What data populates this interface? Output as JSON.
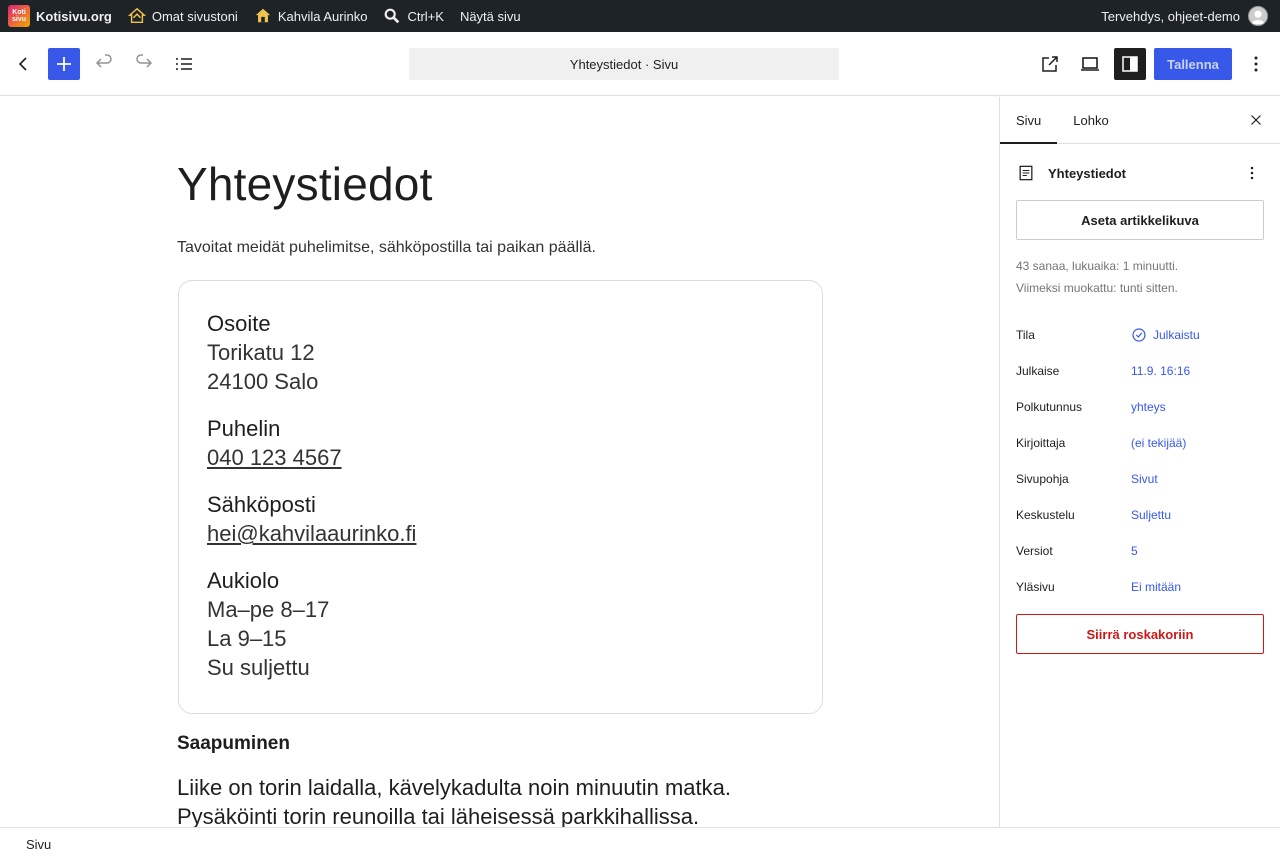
{
  "adminbar": {
    "logo_text": "Koti sivu",
    "site_name": "Kotisivu.org",
    "my_sites": "Omat sivustoni",
    "site": "Kahvila Aurinko",
    "search": "Ctrl+K",
    "view_page": "Näytä sivu",
    "greeting": "Tervehdys, ohjeet-demo"
  },
  "header": {
    "document_title": "Yhteystiedot · Sivu",
    "save_label": "Tallenna"
  },
  "content": {
    "title": "Yhteystiedot",
    "lead": "Tavoitat meidät puhelimitse, sähköpostilla tai paikan päällä.",
    "address": {
      "heading": "Osoite",
      "lines": [
        "Torikatu 12",
        "24100 Salo"
      ]
    },
    "phone": {
      "heading": "Puhelin",
      "value": "040 123 4567"
    },
    "email": {
      "heading": "Sähköposti",
      "value": "hei@kahvilaaurinko.fi"
    },
    "hours": {
      "heading": "Aukiolo",
      "lines": [
        "Ma–pe 8–17",
        "La 9–15",
        "Su suljettu"
      ]
    },
    "arrival_heading": "Saapuminen",
    "arrival_text": "Liike on torin laidalla, kävelykadulta noin minuutin matka. Pysäköinti torin reunoilla tai läheisessä parkkihallissa."
  },
  "sidebar": {
    "tabs": [
      "Sivu",
      "Lohko"
    ],
    "doc_title": "Yhteystiedot",
    "featured_image": "Aseta artikkelikuva",
    "meta_line1": "43 sanaa, lukuaika: 1 minuutti.",
    "meta_line2": "Viimeksi muokattu: tunti sitten.",
    "rows": [
      {
        "label": "Tila",
        "value": "Julkaistu"
      },
      {
        "label": "Julkaise",
        "value": "11.9. 16:16"
      },
      {
        "label": "Polkutunnus",
        "value": "yhteys"
      },
      {
        "label": "Kirjoittaja",
        "value": "(ei tekijää)"
      },
      {
        "label": "Sivupohja",
        "value": "Sivut"
      },
      {
        "label": "Keskustelu",
        "value": "Suljettu"
      },
      {
        "label": "Versiot",
        "value": "5"
      },
      {
        "label": "Yläsivu",
        "value": "Ei mitään"
      }
    ],
    "trash": "Siirrä roskakoriin"
  },
  "footer": {
    "breadcrumb": "Sivu"
  },
  "colors": {
    "accent": "#3858e9",
    "danger": "#cc1818",
    "adminbar": "#1d2327"
  }
}
